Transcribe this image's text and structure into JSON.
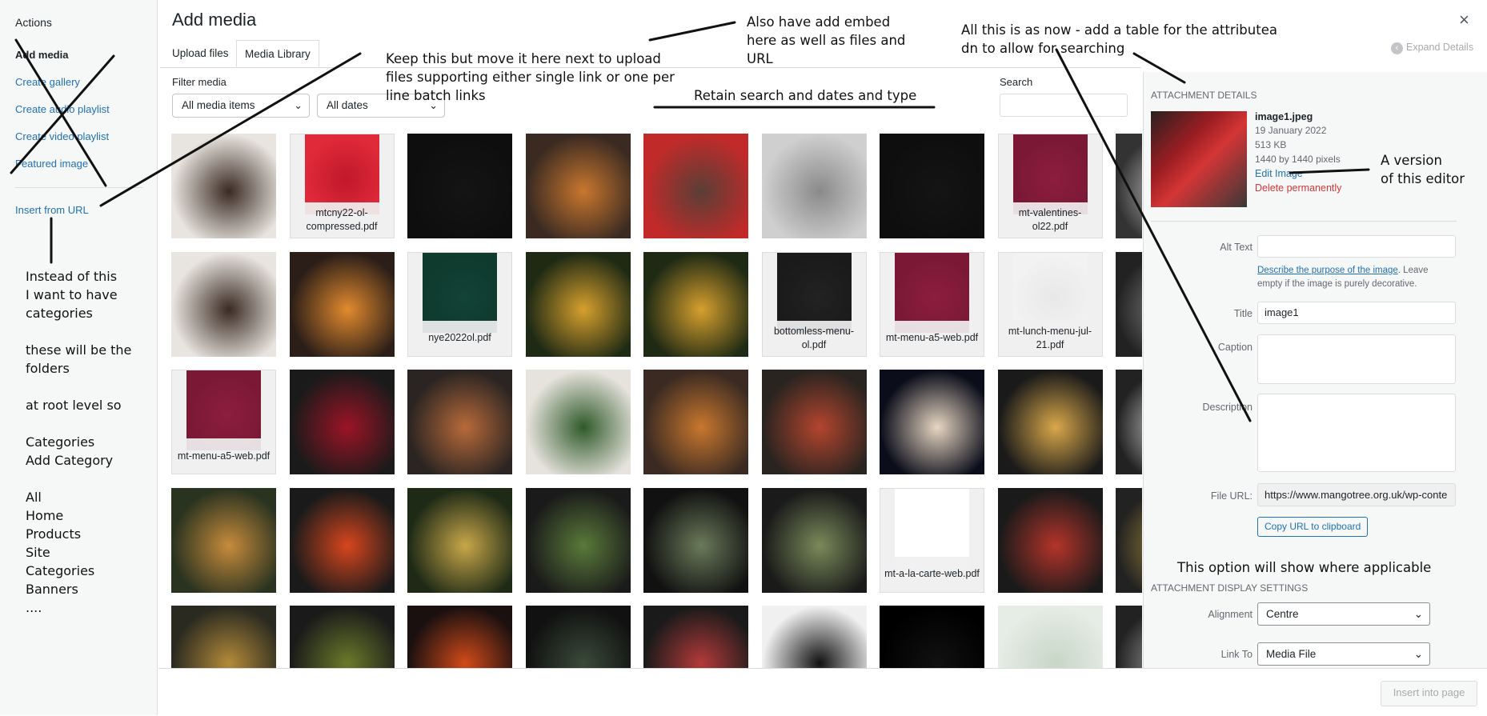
{
  "sidebar": {
    "heading": "Actions",
    "items": [
      {
        "label": "Add media"
      },
      {
        "label": "Create gallery"
      },
      {
        "label": "Create audio playlist"
      },
      {
        "label": "Create video playlist"
      },
      {
        "label": "Featured image"
      },
      {
        "label": "Insert from URL"
      }
    ]
  },
  "header": {
    "title": "Add media",
    "close": "×",
    "expand_details": "Expand Details",
    "tabs": [
      {
        "label": "Upload files"
      },
      {
        "label": "Media Library"
      }
    ]
  },
  "filters": {
    "label": "Filter media",
    "type_value": "All media items",
    "date_value": "All dates",
    "search_label": "Search",
    "search_value": ""
  },
  "grid": {
    "rows": [
      [
        {
          "kind": "img",
          "c1": "#e8e4df",
          "c2": "#3a2a22"
        },
        {
          "kind": "pdf",
          "name": "mtcny22-ol-compressed.pdf",
          "c1": "#e02a3a",
          "c2": "#c0182a"
        },
        {
          "kind": "img",
          "c1": "#0e0e0e",
          "c2": "#141414"
        },
        {
          "kind": "img",
          "c1": "#3a2a22",
          "c2": "#c9772e"
        },
        {
          "kind": "img",
          "c1": "#c22a2a",
          "c2": "#5a3f36"
        },
        {
          "kind": "img",
          "c1": "#cfcfcf",
          "c2": "#8a8a8a"
        },
        {
          "kind": "img",
          "c1": "#0e0e0e",
          "c2": "#141414"
        },
        {
          "kind": "pdf",
          "name": "mt-valentines-ol22.pdf",
          "c1": "#7a1836",
          "c2": "#8c1d3f"
        },
        {
          "kind": "img",
          "c1": "#333",
          "c2": "#ccc"
        }
      ],
      [
        {
          "kind": "img",
          "c1": "#e8e4df",
          "c2": "#3a2a22"
        },
        {
          "kind": "img",
          "c1": "#2b1e18",
          "c2": "#e28a2e"
        },
        {
          "kind": "pdf",
          "name": "nye2022ol.pdf",
          "c1": "#0f3a2e",
          "c2": "#134236"
        },
        {
          "kind": "img",
          "c1": "#1f2a14",
          "c2": "#d7a02e"
        },
        {
          "kind": "img",
          "c1": "#1f2a14",
          "c2": "#d7a02e"
        },
        {
          "kind": "pdf",
          "name": "bottomless-menu-ol.pdf",
          "c1": "#1a1a1a",
          "c2": "#222"
        },
        {
          "kind": "pdf",
          "name": "mt-menu-a5-web.pdf",
          "c1": "#7a1836",
          "c2": "#8c1d3f"
        },
        {
          "kind": "pdf",
          "name": "mt-lunch-menu-jul-21.pdf",
          "c1": "#f2f2f2",
          "c2": "#e8e8e8"
        },
        {
          "kind": "img",
          "c1": "#222",
          "c2": "#888"
        }
      ],
      [
        {
          "kind": "pdf",
          "name": "mt-menu-a5-web.pdf",
          "c1": "#7a1836",
          "c2": "#8c1d3f"
        },
        {
          "kind": "img",
          "c1": "#1a1a1a",
          "c2": "#9c1426"
        },
        {
          "kind": "img",
          "c1": "#2a2422",
          "c2": "#b86a3a"
        },
        {
          "kind": "img",
          "c1": "#e6e2dc",
          "c2": "#2f5a2a"
        },
        {
          "kind": "img",
          "c1": "#3a2a22",
          "c2": "#c9772e"
        },
        {
          "kind": "img",
          "c1": "#2a2420",
          "c2": "#b4452e"
        },
        {
          "kind": "img",
          "c1": "#0b0d1a",
          "c2": "#e7d6c2"
        },
        {
          "kind": "img",
          "c1": "#1a1a1a",
          "c2": "#d9a84a"
        },
        {
          "kind": "img",
          "c1": "#222",
          "c2": "#ddd"
        }
      ],
      [
        {
          "kind": "img",
          "c1": "#2a3320",
          "c2": "#c78b3c"
        },
        {
          "kind": "img",
          "c1": "#1a1a1a",
          "c2": "#d7461e"
        },
        {
          "kind": "img",
          "c1": "#1e2a16",
          "c2": "#c8a74a"
        },
        {
          "kind": "img",
          "c1": "#1a1a1a",
          "c2": "#5a7a3a"
        },
        {
          "kind": "img",
          "c1": "#111",
          "c2": "#6a7a5a"
        },
        {
          "kind": "img",
          "c1": "#1a1a1a",
          "c2": "#7a8a5a"
        },
        {
          "kind": "pdf",
          "name": "mt-a-la-carte-web.pdf",
          "c1": "#ffffff",
          "c2": "#fff"
        },
        {
          "kind": "img",
          "c1": "#1a1a1a",
          "c2": "#b4342a"
        },
        {
          "kind": "img",
          "c1": "#222",
          "c2": "#a88a3a"
        }
      ],
      [
        {
          "kind": "img",
          "c1": "#2a2a20",
          "c2": "#b48a3a"
        },
        {
          "kind": "img",
          "c1": "#1a1a1a",
          "c2": "#6a7a2a"
        },
        {
          "kind": "img",
          "c1": "#1a1010",
          "c2": "#d14a1a"
        },
        {
          "kind": "img",
          "c1": "#111",
          "c2": "#3a4a3a"
        },
        {
          "kind": "img",
          "c1": "#1a1a1a",
          "c2": "#b43a3a"
        },
        {
          "kind": "img",
          "c1": "#f0f0f0",
          "c2": "#111"
        },
        {
          "kind": "img",
          "c1": "#000",
          "c2": "#111"
        },
        {
          "kind": "img",
          "c1": "#e6ece6",
          "c2": "#c7d6c7"
        },
        {
          "kind": "img",
          "c1": "#222",
          "c2": "#aaa"
        }
      ]
    ]
  },
  "details": {
    "section": "ATTACHMENT DETAILS",
    "filename": "image1.jpeg",
    "date": "19 January 2022",
    "size": "513 KB",
    "dimensions": "1440 by 1440 pixels",
    "edit": "Edit Image",
    "delete": "Delete permanently",
    "alt_label": "Alt Text",
    "alt_value": "",
    "alt_help_link": "Describe the purpose of the image",
    "alt_help_rest": ". Leave empty if the image is purely decorative.",
    "title_label": "Title",
    "title_value": "image1",
    "caption_label": "Caption",
    "description_label": "Description",
    "url_label": "File URL:",
    "url_value": "https://www.mangotree.org.uk/wp-conte",
    "copy_label": "Copy URL to clipboard",
    "display_section": "ATTACHMENT DISPLAY SETTINGS",
    "alignment_label": "Alignment",
    "alignment_value": "Centre",
    "linkto_label": "Link To",
    "linkto_value": "Media File"
  },
  "footer": {
    "insert_label": "Insert into page"
  },
  "notes": {
    "keep_move": "Keep this but move it here next to upload\nfiles supporting either single link or one per\nline batch links",
    "add_embed": "Also have add embed\nhere as well as files and\nURL",
    "as_now": "All this is as now - add a table for the attributea\ndn to allow for searching",
    "retain": "Retain search and dates and type",
    "version": "A version\nof this editor",
    "categories": "Instead of this\nI want to have\ncategories\n\nthese will be the\nfolders\n\nat root level so\n\nCategories\nAdd Category\n\nAll\nHome\nProducts\nSite\nCategories\nBanners\n....",
    "option_show": "This option will show where applicable"
  }
}
